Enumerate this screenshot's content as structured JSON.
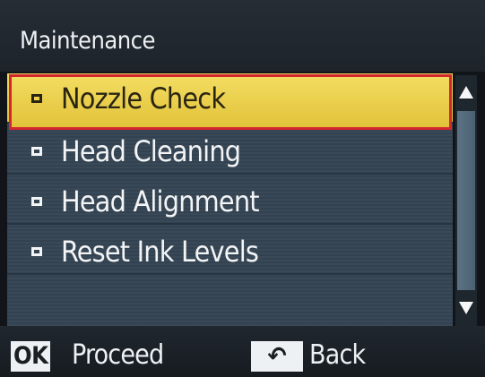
{
  "header": {
    "title": "Maintenance"
  },
  "menu": {
    "selected_index": 0,
    "items": [
      {
        "label": "Nozzle Check"
      },
      {
        "label": "Head Cleaning"
      },
      {
        "label": "Head Alignment"
      },
      {
        "label": "Reset Ink Levels"
      }
    ]
  },
  "scrollbar": {
    "up_icon": "triangle-up",
    "down_icon": "triangle-down"
  },
  "footer": {
    "ok_key": "OK",
    "ok_action": "Proceed",
    "back_key_icon": "return-arrow-icon",
    "back_key_glyph": "↶",
    "back_action": "Back"
  },
  "colors": {
    "selection_fill": "#e9cf4a",
    "selection_border": "#d3262f",
    "list_background": "#3a4957",
    "text_light": "#f2f4f6"
  }
}
